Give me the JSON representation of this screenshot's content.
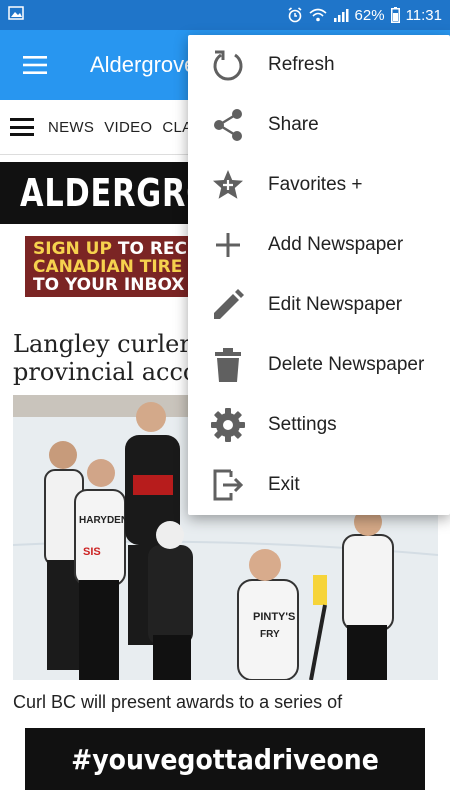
{
  "status_bar": {
    "battery": "62%",
    "time": "11:31"
  },
  "app_bar": {
    "title": "Aldergrove"
  },
  "site_nav": {
    "items": [
      "NEWS",
      "VIDEO",
      "CLA"
    ]
  },
  "masthead": {
    "text": "ALDERGROVE"
  },
  "ad_banner": {
    "line1_highlight": "SIGN UP",
    "line1_rest": " TO RECE",
    "line2": "CANADIAN TIRE OF",
    "line3": "TO YOUR INBOX"
  },
  "article": {
    "headline_line1": "Langley curler",
    "headline_line2": "provincial acco",
    "caption": "Curl BC will present awards to a series of",
    "jersey_sponsor": "PINTY'S",
    "player_names": [
      "HARYDEN",
      "FRY"
    ]
  },
  "bottom_ad": {
    "text": "#youvegottadriveone"
  },
  "overflow_menu": {
    "items": [
      {
        "label": "Refresh",
        "icon": "refresh-icon"
      },
      {
        "label": "Share",
        "icon": "share-icon"
      },
      {
        "label": "Favorites +",
        "icon": "star-icon"
      },
      {
        "label": "Add Newspaper",
        "icon": "plus-icon"
      },
      {
        "label": "Edit Newspaper",
        "icon": "pencil-icon"
      },
      {
        "label": "Delete Newspaper",
        "icon": "trash-icon"
      },
      {
        "label": "Settings",
        "icon": "gear-icon"
      },
      {
        "label": "Exit",
        "icon": "exit-icon"
      }
    ]
  },
  "colors": {
    "status_bar": "#1f75c9",
    "app_bar": "#2896f0",
    "menu_icon": "#606060"
  }
}
